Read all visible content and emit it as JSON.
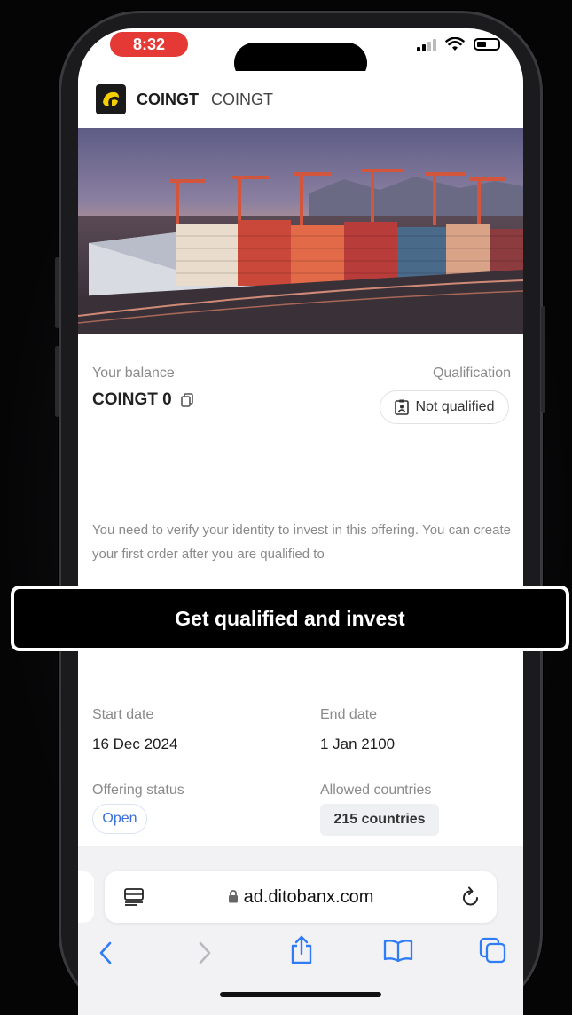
{
  "status": {
    "time": "8:32"
  },
  "header": {
    "brand": "COINGT",
    "brand_secondary": "COINGT"
  },
  "balance": {
    "label": "Your balance",
    "value": "COINGT 0"
  },
  "qualification": {
    "label": "Qualification",
    "status": "Not qualified"
  },
  "note": "You need to verify your identity to invest in this offering. You can create your first order after you are qualified to",
  "cta": {
    "label": "Get qualified and invest"
  },
  "details": {
    "start_label": "Start date",
    "start_value": "16 Dec 2024",
    "end_label": "End date",
    "end_value": "1 Jan 2100",
    "status_label": "Offering status",
    "status_value": "Open",
    "countries_label": "Allowed countries",
    "countries_value": "215 countries"
  },
  "browser": {
    "url": "ad.ditobanx.com"
  },
  "colors": {
    "accent": "#3a6fd8",
    "status_red": "#e53935",
    "logo_yellow": "#f5d000"
  },
  "icons": [
    "copy-icon",
    "clipboard-id-icon",
    "lock-icon",
    "reader-icon",
    "reload-icon",
    "back-icon",
    "forward-icon",
    "share-icon",
    "bookmarks-icon",
    "tabs-icon"
  ]
}
